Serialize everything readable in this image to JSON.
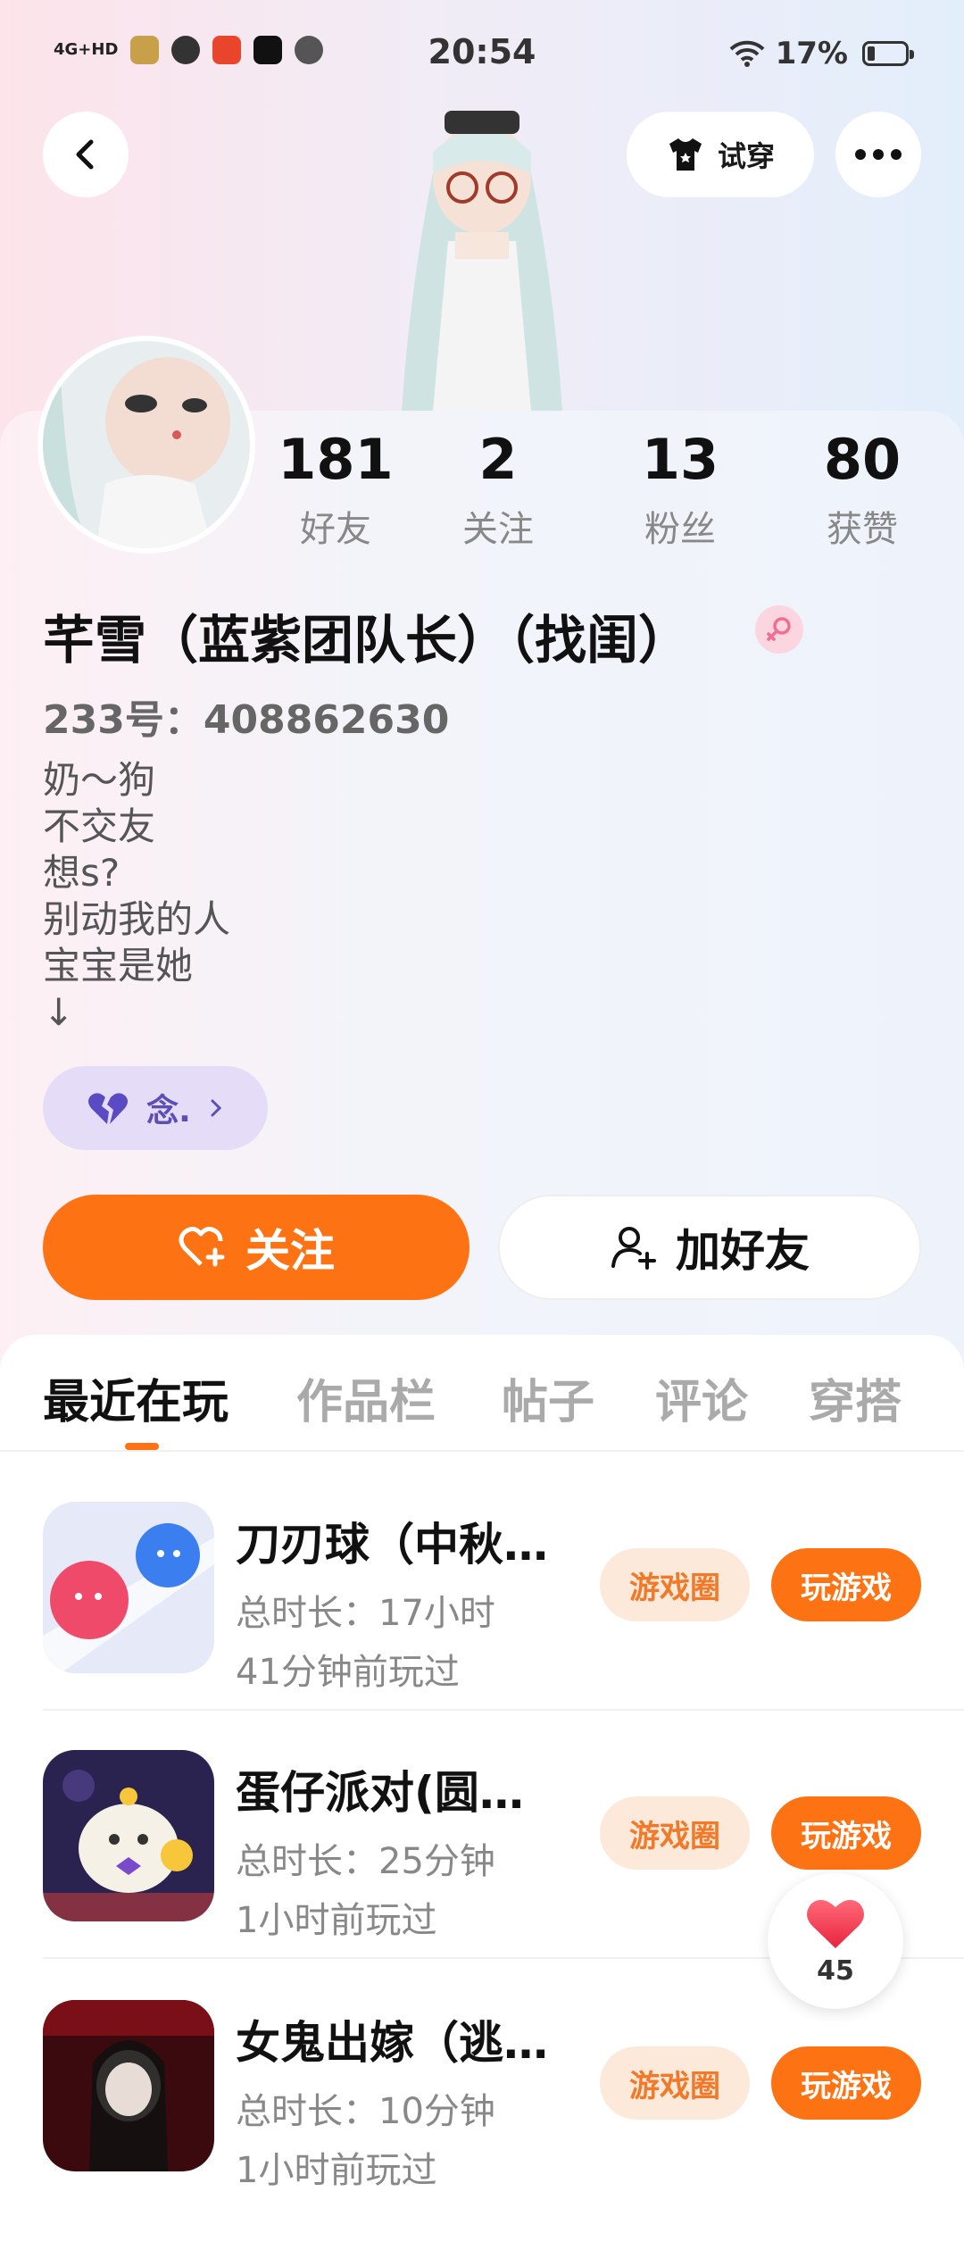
{
  "status_bar": {
    "network": "4G+HD",
    "time": "20:54",
    "battery": "17%"
  },
  "nav": {
    "try_on_label": "试穿"
  },
  "profile": {
    "stats": [
      {
        "value": "181",
        "label": "好友"
      },
      {
        "value": "2",
        "label": "关注"
      },
      {
        "value": "13",
        "label": "粉丝"
      },
      {
        "value": "80",
        "label": "获赞"
      }
    ],
    "name": "芊雪（蓝紫团队长）（找闺）",
    "uid": "233号：408862630",
    "bio": [
      "奶～狗",
      "不交友",
      "想s?",
      "别动我的人",
      "宝宝是她",
      "↓"
    ],
    "tag_label": "念.",
    "follow_label": "关注",
    "add_friend_label": "加好友"
  },
  "tabs": [
    "最近在玩",
    "作品栏",
    "帖子",
    "评论",
    "穿搭"
  ],
  "games": [
    {
      "name": "刀刃球（中秋…",
      "duration": "总时长：17小时",
      "last_played": "41分钟前玩过",
      "circle_label": "游戏圈",
      "play_label": "玩游戏"
    },
    {
      "name": "蛋仔派对(圆…",
      "duration": "总时长：25分钟",
      "last_played": "1小时前玩过",
      "circle_label": "游戏圈",
      "play_label": "玩游戏"
    },
    {
      "name": "女鬼出嫁（逃…",
      "duration": "总时长：10分钟",
      "last_played": "1小时前玩过",
      "circle_label": "游戏圈",
      "play_label": "玩游戏"
    }
  ],
  "like_float": {
    "count": "45"
  },
  "colors": {
    "accent": "#fd7212",
    "tag_bg": "#e5ddf7",
    "circle_pill_bg": "#fde9d9"
  }
}
